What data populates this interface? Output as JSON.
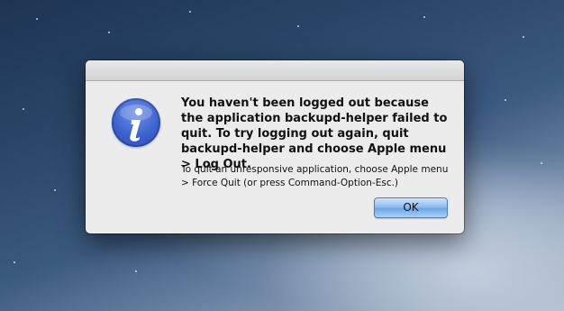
{
  "dialog": {
    "message": "You haven't been logged out because the application backupd-helper failed to quit. To try logging out again, quit backupd-helper and choose Apple menu > Log Out.",
    "info": "To quit an unresponsive application, choose Apple menu > Force Quit (or press Command-Option-Esc.)",
    "ok_label": "OK",
    "icon": "info-icon"
  },
  "colors": {
    "icon_fill": "#3d63d0",
    "button_accent": "#6ea6ea"
  }
}
